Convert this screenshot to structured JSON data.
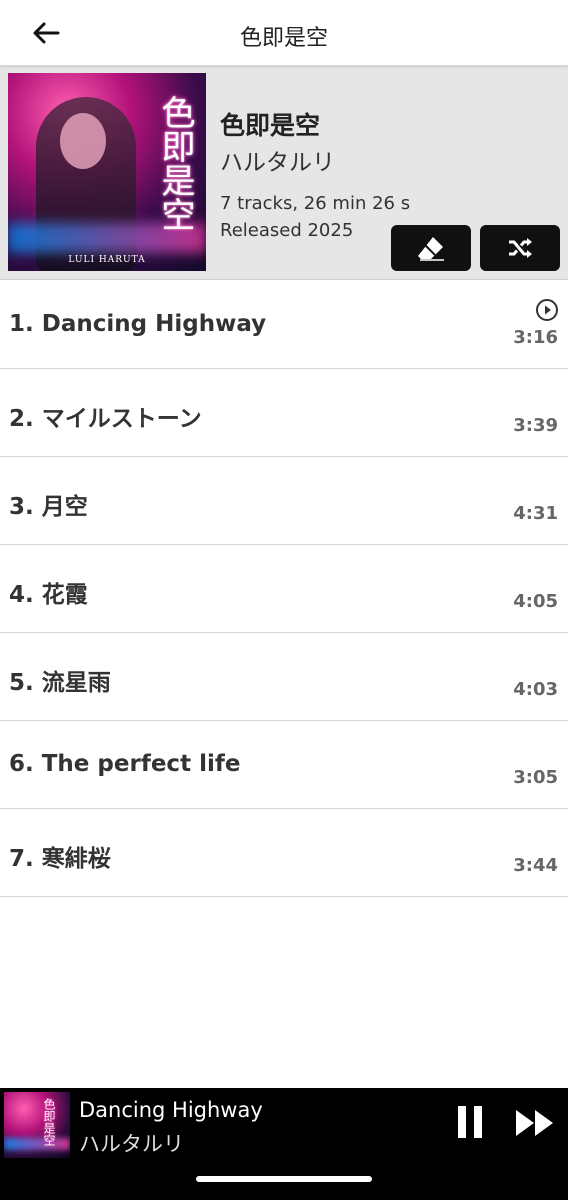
{
  "topbar": {
    "title": "色即是空"
  },
  "album": {
    "title": "色即是空",
    "artist": "ハルタルリ",
    "meta": "7 tracks, 26 min 26 s",
    "released": "Released 2025",
    "cover_logo": "色即是空",
    "cover_artist_en": "LULI HARUTA"
  },
  "tracks": [
    {
      "title": "1. Dancing Highway",
      "duration": "3:16",
      "playing": true
    },
    {
      "title": "2. マイルストーン",
      "duration": "3:39"
    },
    {
      "title": "3. 月空",
      "duration": "4:31"
    },
    {
      "title": "4. 花霞",
      "duration": "4:05"
    },
    {
      "title": "5. 流星雨",
      "duration": "4:03"
    },
    {
      "title": "6. The perfect life",
      "duration": "3:05"
    },
    {
      "title": "7. 寒緋桜",
      "duration": "3:44"
    }
  ],
  "now_playing": {
    "title": "Dancing Highway",
    "artist": "ハルタルリ",
    "cover_logo": "色即是空"
  },
  "icons": {
    "back": "arrow-left-icon",
    "edit": "eraser-pencil-icon",
    "shuffle": "shuffle-icon",
    "play_indicator": "play-circle-icon",
    "pause": "pause-icon",
    "next": "skip-next-icon"
  },
  "colors": {
    "header_bg": "#e6e6e6",
    "button_bg": "#101010",
    "player_bg": "#000000",
    "track_text": "#333333",
    "duration_text": "#666666"
  }
}
